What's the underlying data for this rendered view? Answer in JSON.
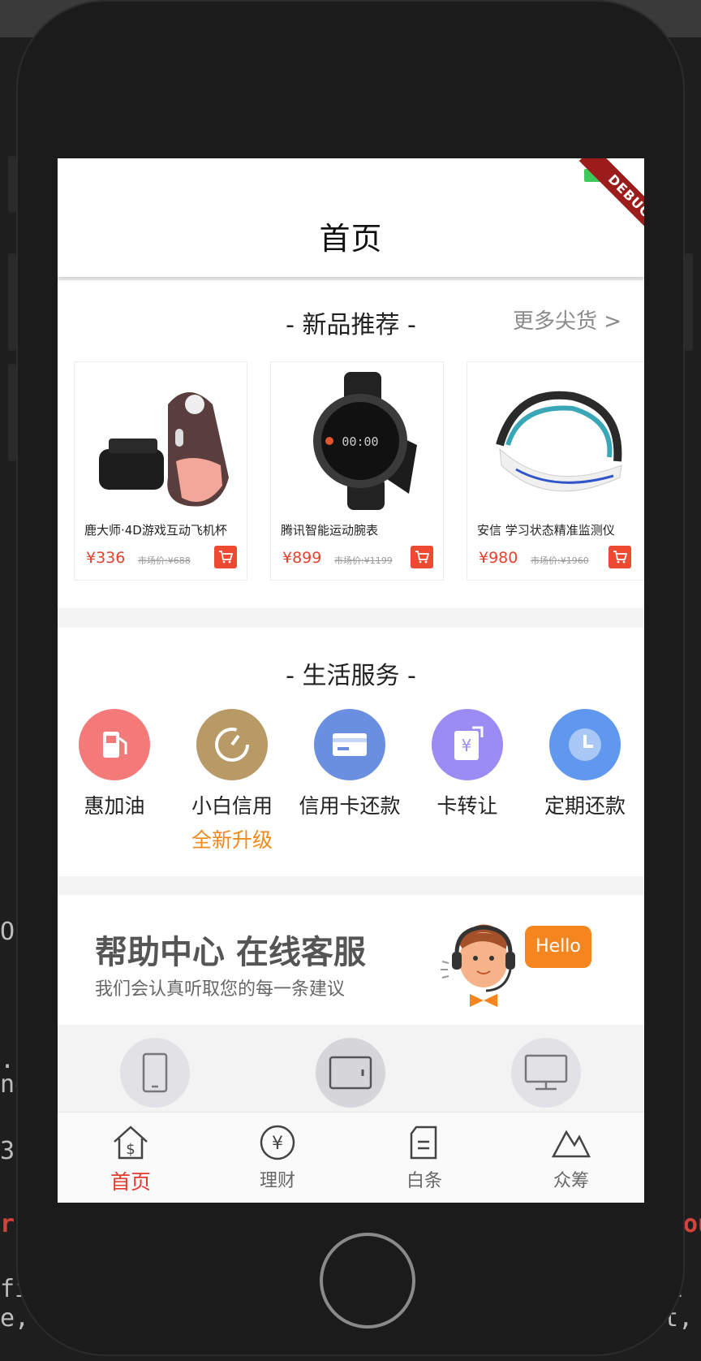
{
  "app_title": "首页",
  "debug_banner": "DEBUG",
  "new_products": {
    "title": "- 新品推荐 -",
    "more": "更多尖货 >",
    "items": [
      {
        "name": "鹿大师·4D游戏互动飞机杯",
        "price": "¥336",
        "market_price": "市场价:¥688"
      },
      {
        "name": "腾讯智能运动腕表",
        "price": "¥899",
        "market_price": "市场价:¥1199"
      },
      {
        "name": "安信 学习状态精准监测仪",
        "price": "¥980",
        "market_price": "市场价:¥1960"
      }
    ]
  },
  "life_services": {
    "title": "- 生活服务 -",
    "items": [
      {
        "label": "惠加油",
        "sub": "",
        "icon": "fuel-pump-icon",
        "color": "#f47a7a"
      },
      {
        "label": "小白信用",
        "sub": "全新升级",
        "icon": "gauge-icon",
        "color": "#b89a66"
      },
      {
        "label": "信用卡还款",
        "sub": "",
        "icon": "credit-card-icon",
        "color": "#6b8fe0"
      },
      {
        "label": "卡转让",
        "sub": "",
        "icon": "yen-transfer-icon",
        "color": "#9a8cf2"
      },
      {
        "label": "定期还款",
        "sub": "",
        "icon": "clock-icon",
        "color": "#5f98ee"
      }
    ]
  },
  "help": {
    "title": "帮助中心 在线客服",
    "subtitle": "我们会认真听取您的每一条建议",
    "bubble": "Hello"
  },
  "tabs": [
    {
      "label": "首页",
      "icon": "home-money-icon",
      "active": true
    },
    {
      "label": "理财",
      "icon": "yen-circle-icon",
      "active": false
    },
    {
      "label": "白条",
      "icon": "document-icon",
      "active": false
    },
    {
      "label": "众筹",
      "icon": "mountain-icon",
      "active": false
    }
  ],
  "colors": {
    "accent": "#e23a2e",
    "price": "#e5432f",
    "orange": "#f08a1e"
  }
}
